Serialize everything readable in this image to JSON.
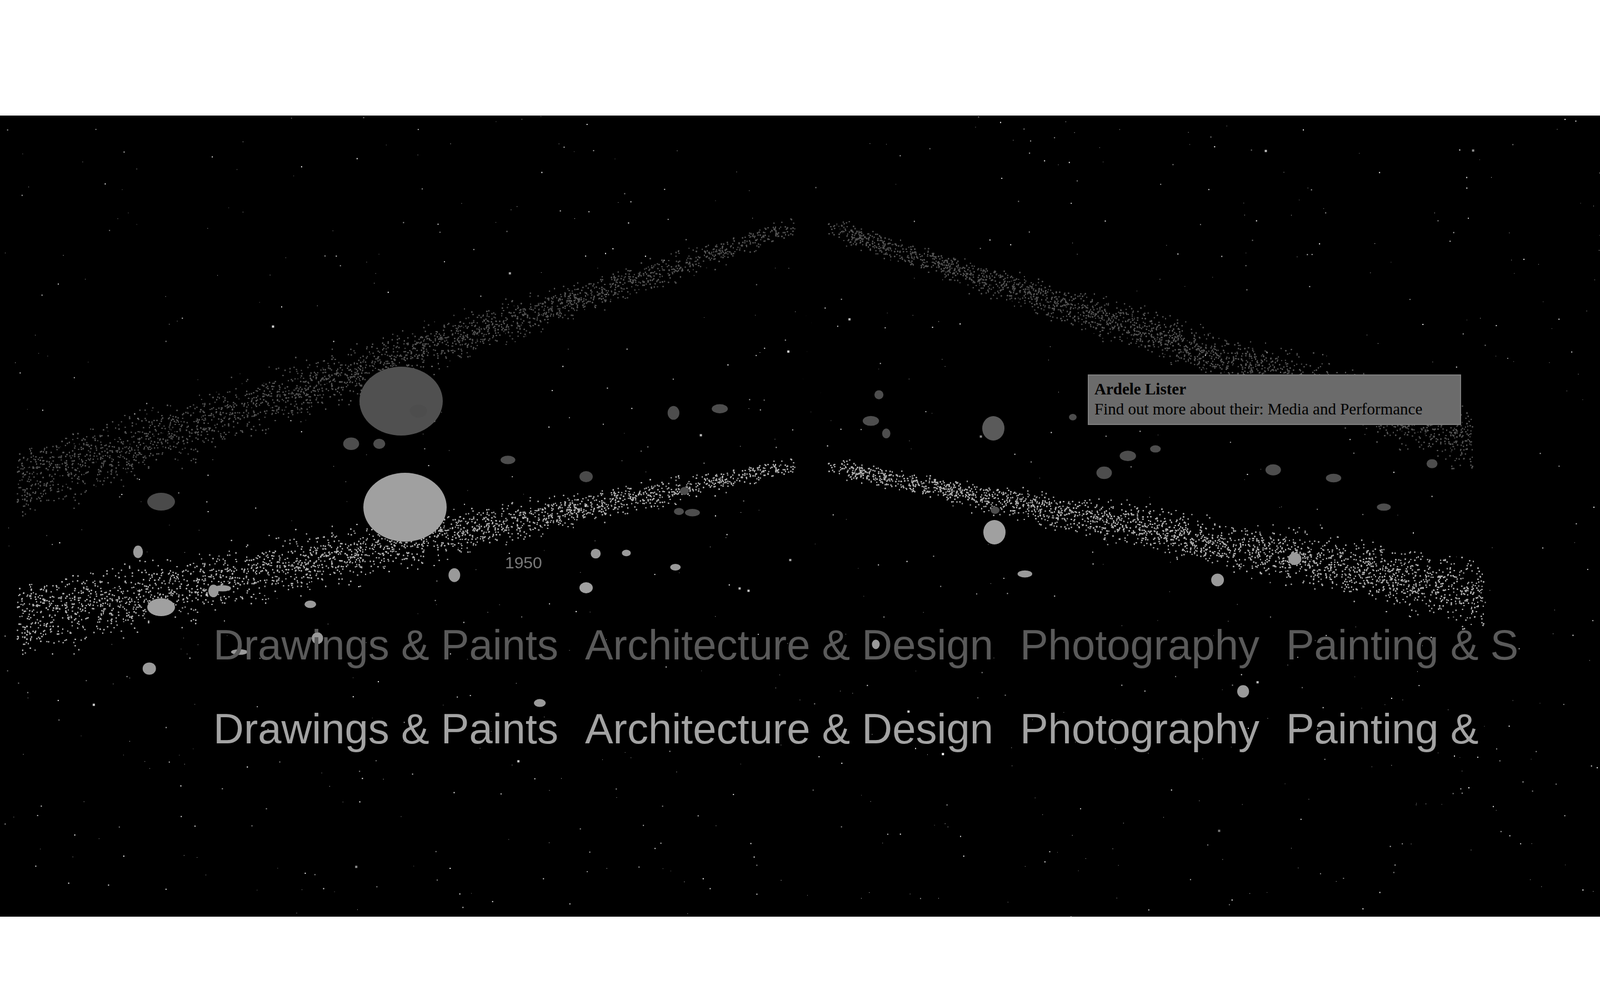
{
  "visualization": {
    "year_labels": [
      "1950"
    ],
    "category_rows": [
      {
        "kind": "back",
        "labels": [
          "Drawings & Paints",
          "Architecture & Design",
          "Photography",
          "Painting & S"
        ]
      },
      {
        "kind": "front",
        "labels": [
          "Drawings & Paints",
          "Architecture & Design",
          "Photography",
          "Painting & "
        ]
      }
    ],
    "tooltip": {
      "title": "Ardele Lister",
      "text": "Find out more about their: Media and Performance"
    }
  }
}
